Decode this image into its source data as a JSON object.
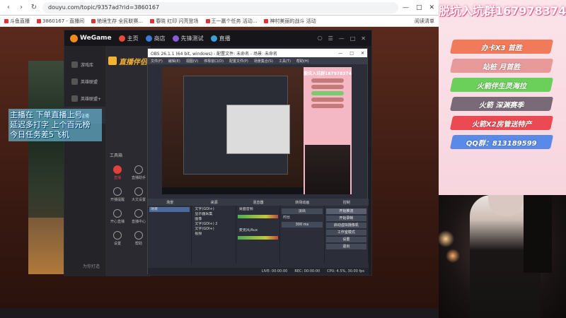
{
  "browser": {
    "url": "douyu.com/topic/9357ad?rid=3860167",
    "controls": [
      "—",
      "□",
      "✕"
    ],
    "bookmarks": [
      "斗鱼直播",
      "3860167 - 直播间",
      "绝境生存 全民联赛...",
      "春晓 红印 闪亮登场",
      "王一赢个任务 活动...",
      "神村美丽的战斗 活动"
    ],
    "bookmark_right": "阅读清单"
  },
  "overlay": {
    "lines": [
      "主播在 下单直播上号",
      "延迟多打字 上个百元榜",
      "今日任务差5飞机"
    ]
  },
  "wegame": {
    "logo": "WeGame",
    "tabs": [
      {
        "label": "主页",
        "color": "#e84a3a"
      },
      {
        "label": "商店",
        "color": "#3a7ad8"
      },
      {
        "label": "先锋测试",
        "color": "#8a5ad8"
      },
      {
        "label": "直播",
        "color": "#3aa0d8"
      }
    ],
    "window_controls": [
      "⎔",
      "☰",
      "—",
      "□",
      "✕"
    ],
    "side": [
      {
        "label": "游戏库",
        "active": false
      },
      {
        "label": "英雄联盟",
        "active": false
      },
      {
        "label": "英雄联盟+",
        "active": false
      },
      {
        "label": "直播",
        "active": true
      }
    ],
    "panel_logo": "直播伴侣",
    "tools_title": "工具箱",
    "tools": [
      {
        "label": "直播",
        "red": true
      },
      {
        "label": "直播助手",
        "red": false
      },
      {
        "label": "开播提醒",
        "red": false
      },
      {
        "label": "大文设置",
        "red": false
      },
      {
        "label": "开心直播",
        "red": false
      },
      {
        "label": "直播中心",
        "red": false
      },
      {
        "label": "设置",
        "red": false
      },
      {
        "label": "帮助",
        "red": false
      }
    ],
    "footer": "为你打造"
  },
  "obs": {
    "title": "OBS 26.1.1 (64 bit, windows) - 配置文件: 未命名 - 场景: 未命名",
    "window_controls": [
      "—",
      "□",
      "✕"
    ],
    "menus": [
      "文件(F)",
      "编辑(E)",
      "视图(V)",
      "停靠窗口(D)",
      "配置文件(P)",
      "场景集合(S)",
      "工具(T)",
      "帮助(H)"
    ],
    "preview_banner": "脱坑入坑群167978374",
    "docks": [
      "场景",
      "来源",
      "混音器",
      "转场动画",
      "控制"
    ],
    "scenes": [
      "场景"
    ],
    "sources": [
      "文字(GDI+)",
      "显示器采集",
      "图像",
      "文字(GDI+) 2",
      "文字(GDI+)",
      "视频"
    ],
    "mixer": [
      "桌面音频",
      "麦克风/Aux"
    ],
    "transition": {
      "type": "淡出",
      "duration_label": "时长",
      "duration": "300 ms"
    },
    "controls": [
      "开始推流",
      "开始录制",
      "启动虚拟摄像机",
      "工作室模式",
      "设置",
      "退出"
    ],
    "status": [
      "LIVE: 00:00:00",
      "REC: 00:00:00",
      "CPU: 4.5%, 30.00 fps"
    ]
  },
  "right_panel": {
    "group_title": "脱坑入坑群167978374",
    "menu": [
      {
        "label": "办卡X3 首胜",
        "color": "#f07a5a"
      },
      {
        "label": "站桩 月首胜",
        "color": "#e89a9a"
      },
      {
        "label": "火箭伴生灵海拉",
        "color": "#6ad05a"
      },
      {
        "label": "火箭 深渊赛季",
        "color": "#7a6a78"
      },
      {
        "label": "火箭X2房管送特产",
        "color": "#ec4a52"
      },
      {
        "label": "QQ群：813189599",
        "color": "#5a8ae8"
      }
    ]
  }
}
